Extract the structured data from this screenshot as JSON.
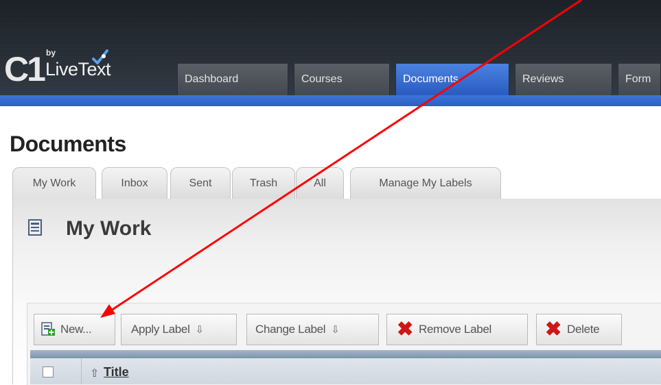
{
  "app": {
    "logo_mark": "C1",
    "logo_by": "by",
    "logo_name": "LiveText"
  },
  "nav": {
    "tabs": [
      {
        "label": "Dashboard",
        "active": false
      },
      {
        "label": "Courses",
        "active": false
      },
      {
        "label": "Documents",
        "active": true
      },
      {
        "label": "Reviews",
        "active": false
      },
      {
        "label": "Form",
        "active": false
      }
    ]
  },
  "page": {
    "title": "Documents",
    "subtabs": [
      {
        "label": "My Work",
        "active": true
      },
      {
        "label": "Inbox",
        "active": false
      },
      {
        "label": "Sent",
        "active": false
      },
      {
        "label": "Trash",
        "active": false
      },
      {
        "label": "All",
        "active": false
      },
      {
        "label": "Manage My Labels",
        "active": false
      }
    ],
    "section_title": "My Work",
    "section_icon": "document-icon"
  },
  "toolbar": {
    "new_label": "New...",
    "apply_label": "Apply Label",
    "change_label": "Change Label",
    "remove_label": "Remove Label",
    "delete_label": "Delete",
    "dropdown_arrow": "⇩",
    "remove_glyph": "✖"
  },
  "table": {
    "columns": [
      {
        "label": "Title",
        "sort_glyph": "⇧"
      }
    ]
  },
  "colors": {
    "active_tab": "#3d74d8",
    "header_bg": "#272e36",
    "annotation_arrow": "#ff0000",
    "delete_x": "#d01616"
  }
}
